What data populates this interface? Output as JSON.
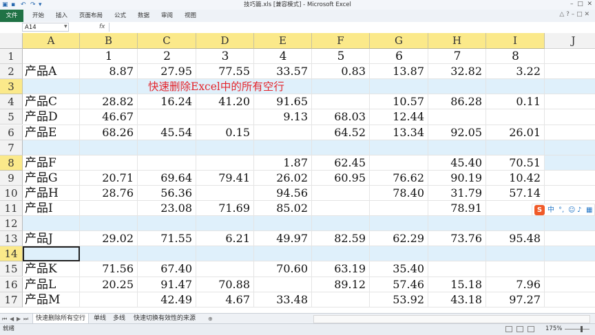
{
  "window": {
    "title": "技巧篇.xls  [兼容模式]  -  Microsoft Excel"
  },
  "ribbon": {
    "file_label": "文件",
    "tabs": [
      "开始",
      "插入",
      "页面布局",
      "公式",
      "数据",
      "审阅",
      "视图"
    ]
  },
  "formula_bar": {
    "name_box": "A14",
    "fx_label": "fx",
    "formula": ""
  },
  "columns": [
    "A",
    "B",
    "C",
    "D",
    "E",
    "F",
    "G",
    "H",
    "I",
    "J"
  ],
  "rows": [
    {
      "n": "1",
      "cells": [
        "",
        "1",
        "2",
        "3",
        "4",
        "5",
        "6",
        "7",
        "8"
      ]
    },
    {
      "n": "2",
      "cells": [
        "产品A",
        "8.87",
        "27.95",
        "77.55",
        "33.57",
        "0.83",
        "13.87",
        "32.82",
        "3.22"
      ]
    },
    {
      "n": "3",
      "cells": [
        "",
        "",
        "",
        "",
        "",
        "",
        "",
        "",
        ""
      ]
    },
    {
      "n": "4",
      "cells": [
        "产品C",
        "28.82",
        "16.24",
        "41.20",
        "91.65",
        "",
        "10.57",
        "86.28",
        "0.11"
      ]
    },
    {
      "n": "5",
      "cells": [
        "产品D",
        "46.67",
        "",
        "",
        "9.13",
        "68.03",
        "12.44",
        "",
        ""
      ]
    },
    {
      "n": "6",
      "cells": [
        "产品E",
        "68.26",
        "45.54",
        "0.15",
        "",
        "64.52",
        "13.34",
        "92.05",
        "26.01"
      ]
    },
    {
      "n": "7",
      "cells": [
        "",
        "",
        "",
        "",
        "",
        "",
        "",
        "",
        ""
      ]
    },
    {
      "n": "8",
      "cells": [
        "产品F",
        "",
        "",
        "",
        "1.87",
        "62.45",
        "",
        "45.40",
        "70.51"
      ]
    },
    {
      "n": "9",
      "cells": [
        "产品G",
        "20.71",
        "69.64",
        "79.41",
        "26.02",
        "60.95",
        "76.62",
        "90.19",
        "10.42"
      ]
    },
    {
      "n": "10",
      "cells": [
        "产品H",
        "28.76",
        "56.36",
        "",
        "94.56",
        "",
        "78.40",
        "31.79",
        "57.14"
      ]
    },
    {
      "n": "11",
      "cells": [
        "产品I",
        "",
        "23.08",
        "71.69",
        "85.02",
        "",
        "",
        "78.91",
        ""
      ]
    },
    {
      "n": "12",
      "cells": [
        "",
        "",
        "",
        "",
        "",
        "",
        "",
        "",
        ""
      ]
    },
    {
      "n": "13",
      "cells": [
        "产品J",
        "29.02",
        "71.55",
        "6.21",
        "49.97",
        "82.59",
        "62.29",
        "73.76",
        "95.48"
      ]
    },
    {
      "n": "14",
      "cells": [
        "",
        "",
        "",
        "",
        "",
        "",
        "",
        "",
        ""
      ]
    },
    {
      "n": "15",
      "cells": [
        "产品K",
        "71.56",
        "67.40",
        "",
        "70.60",
        "63.19",
        "35.40",
        "",
        ""
      ]
    },
    {
      "n": "16",
      "cells": [
        "产品L",
        "20.25",
        "91.47",
        "70.88",
        "",
        "89.12",
        "57.46",
        "15.18",
        "7.96"
      ]
    },
    {
      "n": "17",
      "cells": [
        "产品M",
        "",
        "42.49",
        "4.67",
        "33.48",
        "",
        "53.92",
        "43.18",
        "97.27"
      ]
    }
  ],
  "annotation": "快速删除Excel中的所有空行",
  "ime": {
    "chinese": "中"
  },
  "sheet_tabs": [
    "快速删除所有空行",
    "单线",
    "多线",
    "快速切换有效性的来源"
  ],
  "status": {
    "ready": "就绪",
    "zoom": "175%"
  },
  "colors": {
    "header_highlight": "#fbe98a",
    "empty_row_fill": "#dff0fb",
    "annotation": "#e3252c",
    "file_tab": "#207245"
  }
}
